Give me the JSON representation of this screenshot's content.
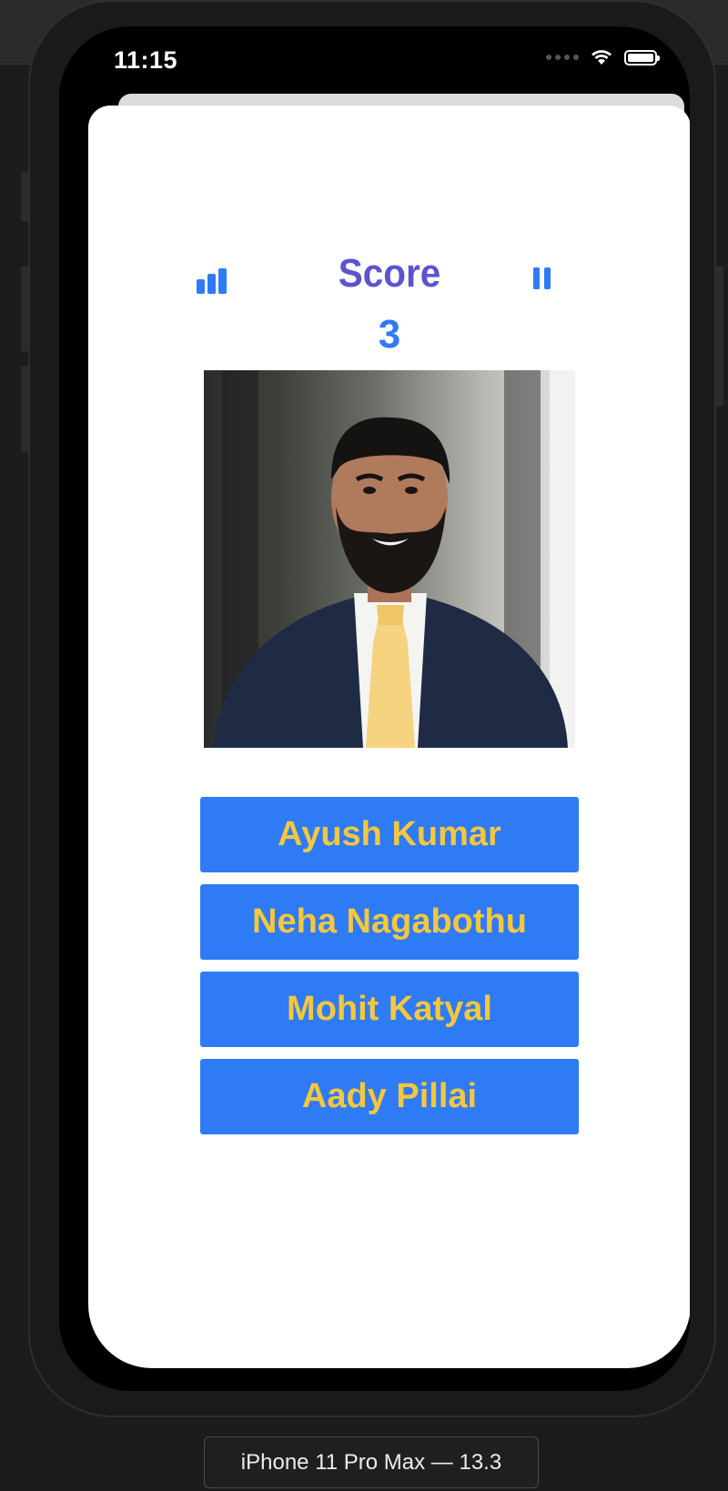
{
  "status_bar": {
    "time": "11:15"
  },
  "header": {
    "stats_icon": "bar-chart-icon",
    "title": "Score",
    "pause_icon": "pause-icon"
  },
  "score": {
    "value": "3"
  },
  "photo": {
    "description_icon": "person-photo"
  },
  "answers": [
    {
      "label": "Ayush Kumar"
    },
    {
      "label": "Neha Nagabothu"
    },
    {
      "label": "Mohit Katyal"
    },
    {
      "label": "Aady Pillai"
    }
  ],
  "simulator": {
    "device": "iPhone 11 Pro Max — 13.3"
  },
  "colors": {
    "accent_blue": "#2f7bf5",
    "title_purple": "#5b54d0",
    "answer_text_yellow": "#f5c73c"
  }
}
